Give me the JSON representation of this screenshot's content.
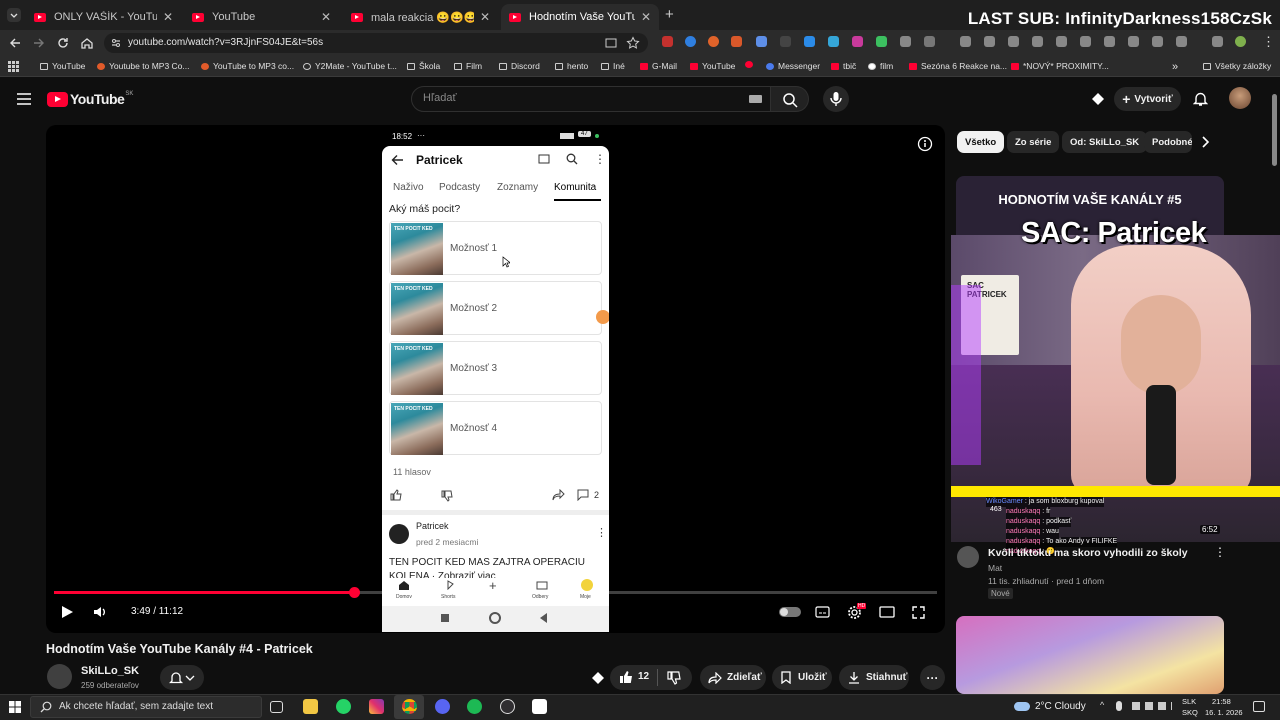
{
  "browser": {
    "tabs": [
      {
        "title": "ONLY VAŠÍK - YouTube",
        "active": false
      },
      {
        "title": "YouTube",
        "active": false
      },
      {
        "title": "mala reakcia 😀😀😀 - YouTube",
        "active": false
      },
      {
        "title": "Hodnotím Vaše YouTube Kanály",
        "active": true
      }
    ],
    "new_tab": "+",
    "url": "youtube.com/watch?v=3RJjnFS04JE&t=56s",
    "bookmarks": [
      "YouTube",
      "Youtube to MP3 Co...",
      "YouTube to MP3 co...",
      "Y2Mate - YouTube t...",
      "Škola",
      "Film",
      "Discord",
      "hento",
      "Iné",
      "G-Mail",
      "YouTube",
      "Messenger",
      "tbič",
      "film",
      "Sezóna 6 Reakce na...",
      "*NOVÝ* PROXIMITY..."
    ],
    "all_bookmarks": "Všetky záložky",
    "chevron": "»"
  },
  "stream_overlay": {
    "last_sub": "LAST SUB: InfinityDarkness158CzSk"
  },
  "header": {
    "logo": "YouTube",
    "country": "SK",
    "search_placeholder": "Hľadať",
    "create_label": "Vytvoriť"
  },
  "player": {
    "time": "3:49 / 11:12",
    "progress_fraction": 0.34,
    "hd_badge": "HD",
    "phone": {
      "status_time": "18:52",
      "status_dots": "···",
      "battery": "47",
      "channel": "Patricek",
      "tabs": [
        "Naživo",
        "Podcasty",
        "Zoznamy",
        "Komunita"
      ],
      "active_tab": "Komunita",
      "question": "Aký máš pocit?",
      "thumb_caption": "TEN POCIT KED",
      "options": [
        "Možnosť 1",
        "Možnosť 2",
        "Možnosť 3",
        "Možnosť 4"
      ],
      "votes": "11 hlasov",
      "comments": "2",
      "post_author": "Patricek",
      "post_time": "pred 2 mesiacmi",
      "post_text_1": "TEN POCIT KED MAS ZAJTRA OPERACIU",
      "post_text_2": "KOLENA · Zobraziť viac",
      "nav": [
        "Domov",
        "Shorts",
        "",
        "Odbery",
        "Moje"
      ]
    }
  },
  "video": {
    "title": "Hodnotím Vaše YouTube Kanály #4 - Patricek",
    "channel": "SkiLLo_SK",
    "subscribers": "259 odberateľov",
    "likes": "12",
    "share": "Zdieľať",
    "save": "Uložiť",
    "download": "Stiahnuť"
  },
  "sidebar": {
    "chips": [
      "Všetko",
      "Zo série",
      "Od: SkiLLo_SK",
      "Podobné"
    ],
    "recommendation": {
      "thumb_title": "HODNOTÍM VAŠE KANÁLY #5",
      "thumb_sub": "SAC: Patricek",
      "duration": "6:52",
      "title": "Kvôli tiktoku ma skoro vyhodili zo školy",
      "channel": "Mat",
      "meta": "11 tis. zhliadnutí · pred 1 dňom",
      "badge": "Nové"
    },
    "poster_label": "SAC PATRICEK",
    "chat": [
      {
        "user": "WikoGamer",
        "text": "ja som bloxburg kupoval"
      },
      {
        "user": "naduskaqq",
        "text": "fr"
      },
      {
        "user": "naduskaqq",
        "text": "podkasť"
      },
      {
        "user": "naduskaqq",
        "text": "wau"
      },
      {
        "user": "naduskaqq",
        "text": "To ako Andy v FILIFKE"
      },
      {
        "user": "naduskaqq",
        "text": "🙂"
      }
    ],
    "chat_viewers": "463"
  },
  "taskbar": {
    "search_placeholder": "Ak chcete hľadať, sem zadajte text",
    "weather": "2°C Cloudy",
    "lang_1": "SLK",
    "lang_2": "SKQ",
    "time": "21:58",
    "date": "16. 1. 2026"
  }
}
